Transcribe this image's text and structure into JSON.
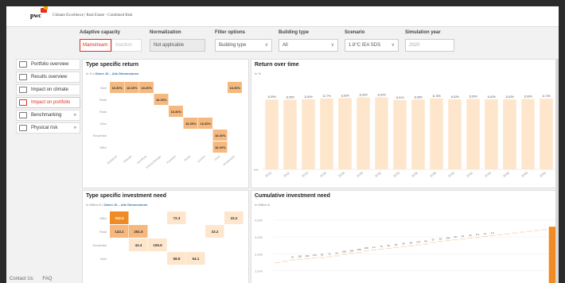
{
  "app": {
    "logo": "pwc",
    "title": "Climate Excellence | Real Estate - Combined Risk"
  },
  "filters": {
    "adaptive_capacity": {
      "label": "Adaptive capacity",
      "options": [
        "Mainstream",
        "Inaction"
      ],
      "selected": "Mainstream"
    },
    "normalization": {
      "label": "Normalization",
      "value": "Not applicable"
    },
    "filter_options": {
      "label": "Filter options",
      "value": "Building type"
    },
    "building_type": {
      "label": "Building type",
      "value": "All"
    },
    "scenario": {
      "label": "Scenario",
      "value": "1.8°C IEA SDS"
    },
    "simulation_year": {
      "label": "Simulation year",
      "placeholder": "2020"
    }
  },
  "nav": {
    "items": [
      {
        "label": "Portfolio overview",
        "icon": "portfolio-icon",
        "chevron": ""
      },
      {
        "label": "Results overview",
        "icon": "results-icon",
        "chevron": ""
      },
      {
        "label": "Impact on climate",
        "icon": "climate-icon",
        "chevron": ""
      },
      {
        "label": "Impact on portfolio",
        "icon": "portfolio-impact-icon",
        "chevron": ""
      },
      {
        "label": "Benchmarking",
        "icon": "benchmark-icon",
        "chevron": "»"
      },
      {
        "label": "Physical risk",
        "icon": "physical-risk-icon",
        "chevron": "»"
      }
    ],
    "active_index": 3
  },
  "footer": {
    "contact": "Contact Us",
    "faq": "FAQ"
  },
  "colors": {
    "accent": "#e0301e",
    "orange": "#f08a24",
    "light_orange": "#fde6cc",
    "mid_orange": "#f5b97f",
    "link": "#3b6ea5"
  },
  "panels": {
    "type_return": {
      "title": "Type specific return",
      "unit": "In %",
      "filter": "Obere 10 – Alle Dimensionen"
    },
    "return_time": {
      "title": "Return over time",
      "unit": "In %"
    },
    "investment_need": {
      "title": "Type specific investment need",
      "unit": "In Million €",
      "filter": "Obere 10 – Alle Dimensionen"
    },
    "cumulative": {
      "title": "Cumulative investment need",
      "unit": "In Million €"
    }
  },
  "chart_data": [
    {
      "type": "heatmap",
      "title": "Type specific return",
      "rows": [
        "Hotel",
        "Retail",
        "Retail",
        "Other",
        "Residential",
        "Office"
      ],
      "columns": [
        "Budapest",
        "Helsinki",
        "Hamburg",
        "Vienna Energie",
        "Frankfurt",
        "Berlin",
        "London",
        "Paris",
        "Amsterdam"
      ],
      "cells": [
        {
          "r": 0,
          "c": 0,
          "label": "18.30%",
          "level": 1
        },
        {
          "r": 0,
          "c": 1,
          "label": "18.30%",
          "level": 1
        },
        {
          "r": 0,
          "c": 2,
          "label": "18.30%",
          "level": 1
        },
        {
          "r": 0,
          "c": 8,
          "label": "18.30%",
          "level": 1
        },
        {
          "r": 1,
          "c": 3,
          "label": "18.30%",
          "level": 1
        },
        {
          "r": 2,
          "c": 4,
          "label": "18.30%",
          "level": 1
        },
        {
          "r": 3,
          "c": 5,
          "label": "18.30%",
          "level": 1
        },
        {
          "r": 3,
          "c": 6,
          "label": "18.30%",
          "level": 1
        },
        {
          "r": 4,
          "c": 7,
          "label": "18.30%",
          "level": 1
        },
        {
          "r": 5,
          "c": 7,
          "label": "18.30%",
          "level": 1
        }
      ]
    },
    {
      "type": "bar",
      "title": "Return over time",
      "categories": [
        "2020",
        "2022",
        "2024",
        "2026",
        "2028",
        "2030",
        "2032",
        "2034",
        "2036",
        "2038",
        "2040",
        "2042",
        "2044",
        "2046",
        "2048",
        "2050"
      ],
      "values": [
        11.59,
        11.55,
        11.63,
        11.77,
        11.83,
        11.94,
        11.94,
        11.51,
        11.58,
        11.78,
        11.63,
        11.69,
        11.63,
        11.63,
        11.69,
        11.73
      ],
      "labels": [
        "11.59%",
        "11.55%",
        "11.63%",
        "11.77%",
        "11.83%",
        "11.94%",
        "11.94%",
        "11.51%",
        "11.58%",
        "11.78%",
        "11.63%",
        "11.69%",
        "11.63%",
        "11.63%",
        "11.69%",
        "11.73%"
      ],
      "ytick": "0%",
      "ylim": [
        0,
        14
      ]
    },
    {
      "type": "heatmap",
      "title": "Type specific investment need",
      "rows": [
        "Office",
        "Retail",
        "Residential",
        "Hotel"
      ],
      "cells": [
        {
          "r": 0,
          "c": 0,
          "label": "332.5",
          "level": 3
        },
        {
          "r": 0,
          "c": 3,
          "label": "72.3",
          "level": 1
        },
        {
          "r": 0,
          "c": 6,
          "label": "33.2",
          "level": 1
        },
        {
          "r": 1,
          "c": 0,
          "label": "143.1",
          "level": 2
        },
        {
          "r": 1,
          "c": 1,
          "label": "261.5",
          "level": 2
        },
        {
          "r": 1,
          "c": 5,
          "label": "33.2",
          "level": 1
        },
        {
          "r": 2,
          "c": 1,
          "label": "44.4",
          "level": 1
        },
        {
          "r": 2,
          "c": 2,
          "label": "106.9",
          "level": 1
        },
        {
          "r": 3,
          "c": 3,
          "label": "58.8",
          "level": 1
        },
        {
          "r": 3,
          "c": 4,
          "label": "54.1",
          "level": 1
        }
      ]
    },
    {
      "type": "bar",
      "title": "Cumulative investment need",
      "yticks": [
        "4,000",
        "3,000",
        "2,000",
        "1,000"
      ],
      "ylim": [
        0,
        4500
      ],
      "values": [
        1500,
        1580,
        1660,
        1700,
        1740,
        1780,
        1800,
        1850,
        1900,
        2000,
        2050,
        2100,
        2200,
        2250,
        2300,
        2350,
        2400,
        2450,
        2500,
        2550,
        2600,
        2700,
        2750,
        2800,
        2850,
        2900,
        2950,
        3000,
        3050,
        3100,
        3150,
        3200,
        3250,
        3300,
        3350,
        3400,
        3450
      ],
      "labels": [
        "79",
        "150",
        "106",
        "179",
        "33",
        "72",
        "54",
        "183",
        "154",
        "158",
        "206",
        "2.2",
        "73",
        "81",
        "55",
        "39",
        "48",
        "174",
        "94",
        "67",
        "81",
        "194",
        "39",
        "12",
        "44",
        "8.1",
        "11",
        "3.3"
      ],
      "last_value": 3600
    }
  ]
}
